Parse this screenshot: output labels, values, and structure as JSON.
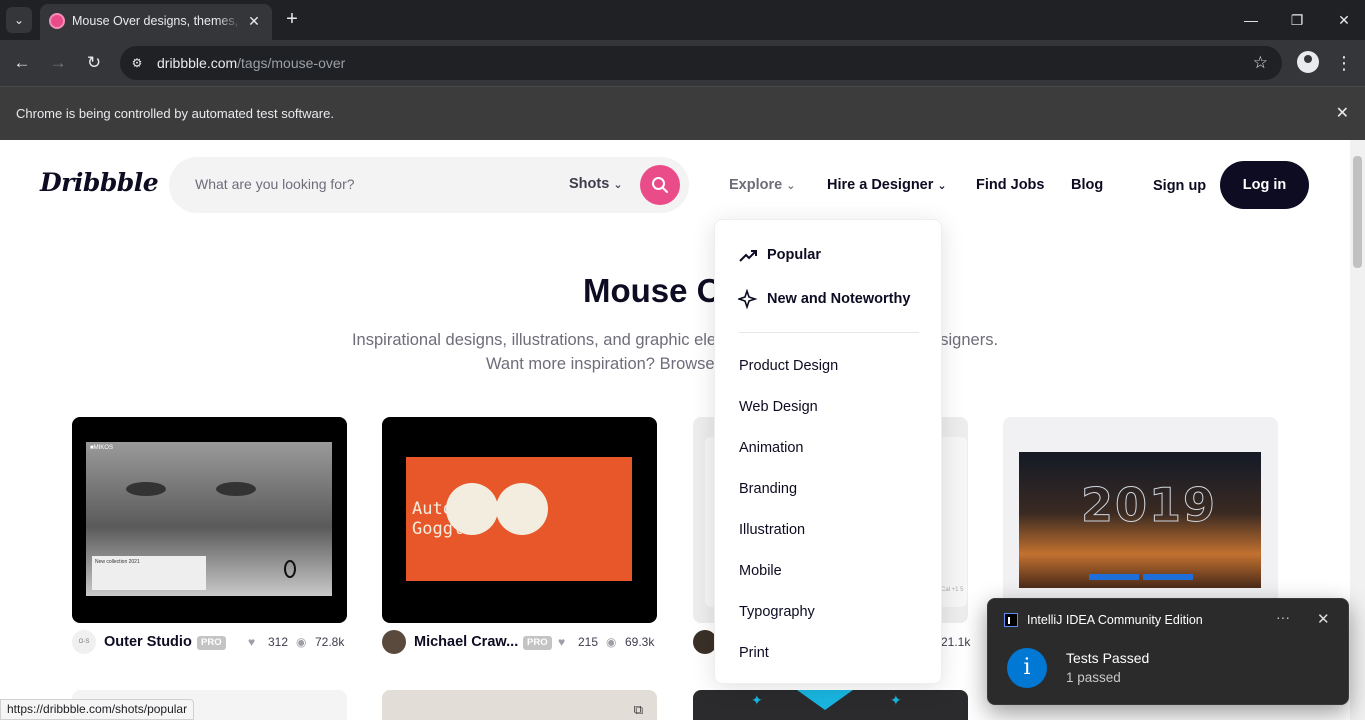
{
  "browser": {
    "tab_title": "Mouse Over designs, themes, templates and downloadable graphic elements on Dribbble",
    "url_host": "dribbble.com",
    "url_path": "/tags/mouse-over",
    "infobar_text": "Chrome is being controlled by automated test software.",
    "status_url": "https://dribbble.com/shots/popular"
  },
  "header": {
    "logo": "Dribbble",
    "search_placeholder": "What are you looking for?",
    "search_scope": "Shots",
    "nav": {
      "explore": "Explore",
      "hire": "Hire a Designer",
      "jobs": "Find Jobs",
      "blog": "Blog"
    },
    "signup": "Sign up",
    "login": "Log in"
  },
  "hero": {
    "title": "Mouse Over designs",
    "subtitle_1": "Inspirational designs, illustrations, and graphic elements from the world's best designers.",
    "subtitle_2": "Want more inspiration? Browse our search results..."
  },
  "explore_menu": {
    "featured": [
      "Popular",
      "New and Noteworthy"
    ],
    "categories": [
      "Product Design",
      "Web Design",
      "Animation",
      "Branding",
      "Illustration",
      "Mobile",
      "Typography",
      "Print"
    ]
  },
  "shots": [
    {
      "author": "Outer Studio",
      "pro": "PRO",
      "likes": "312",
      "views": "72.8k",
      "avatar_text": "O-S",
      "mock_caption": "New collection 2021",
      "brand": "■MIKOS"
    },
    {
      "author": "Michael Craw...",
      "pro": "PRO",
      "likes": "215",
      "views": "69.3k",
      "art_line1": "Autoperfect",
      "art_line2": "Goggles"
    },
    {
      "author": "",
      "pro": "",
      "likes": "",
      "views": "21.1k",
      "partial": "Cal +1 5"
    },
    {
      "author": "",
      "pro": "",
      "likes": "",
      "views": "",
      "year": "2019"
    }
  ],
  "toast": {
    "app": "IntelliJ IDEA Community Edition",
    "title": "Tests Passed",
    "body": "1 passed",
    "icon": "i"
  },
  "colors": {
    "brand_pink": "#ea4c89",
    "dark": "#0d0c22",
    "shot2_orange": "#e8572a"
  }
}
